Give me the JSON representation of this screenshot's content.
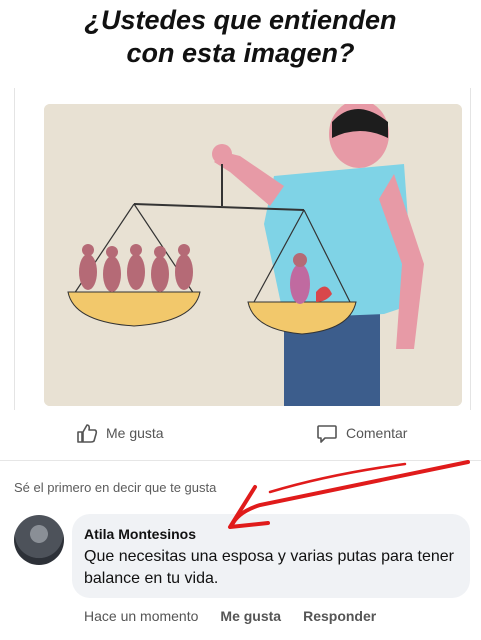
{
  "title": {
    "line1": "¿Ustedes que entienden",
    "line2": "con esta imagen?"
  },
  "post": {
    "actions": {
      "like_label": "Me gusta",
      "comment_label": "Comentar"
    },
    "first_like_text": "Sé el primero en decir que te gusta"
  },
  "comment": {
    "author": "Atila Montesinos",
    "text": "Que necesitas una esposa y varias putas para tener balance en tu vida.",
    "time": "Hace un momento",
    "like_label": "Me gusta",
    "reply_label": "Responder"
  },
  "colors": {
    "accent_red": "#e01b1b",
    "shirt_blue": "#7fd3e6",
    "skin_pink": "#e79aa6",
    "pan_yellow": "#f2c86b"
  },
  "icons": {
    "like": "thumbs-up-icon",
    "comment": "speech-bubble-icon"
  }
}
